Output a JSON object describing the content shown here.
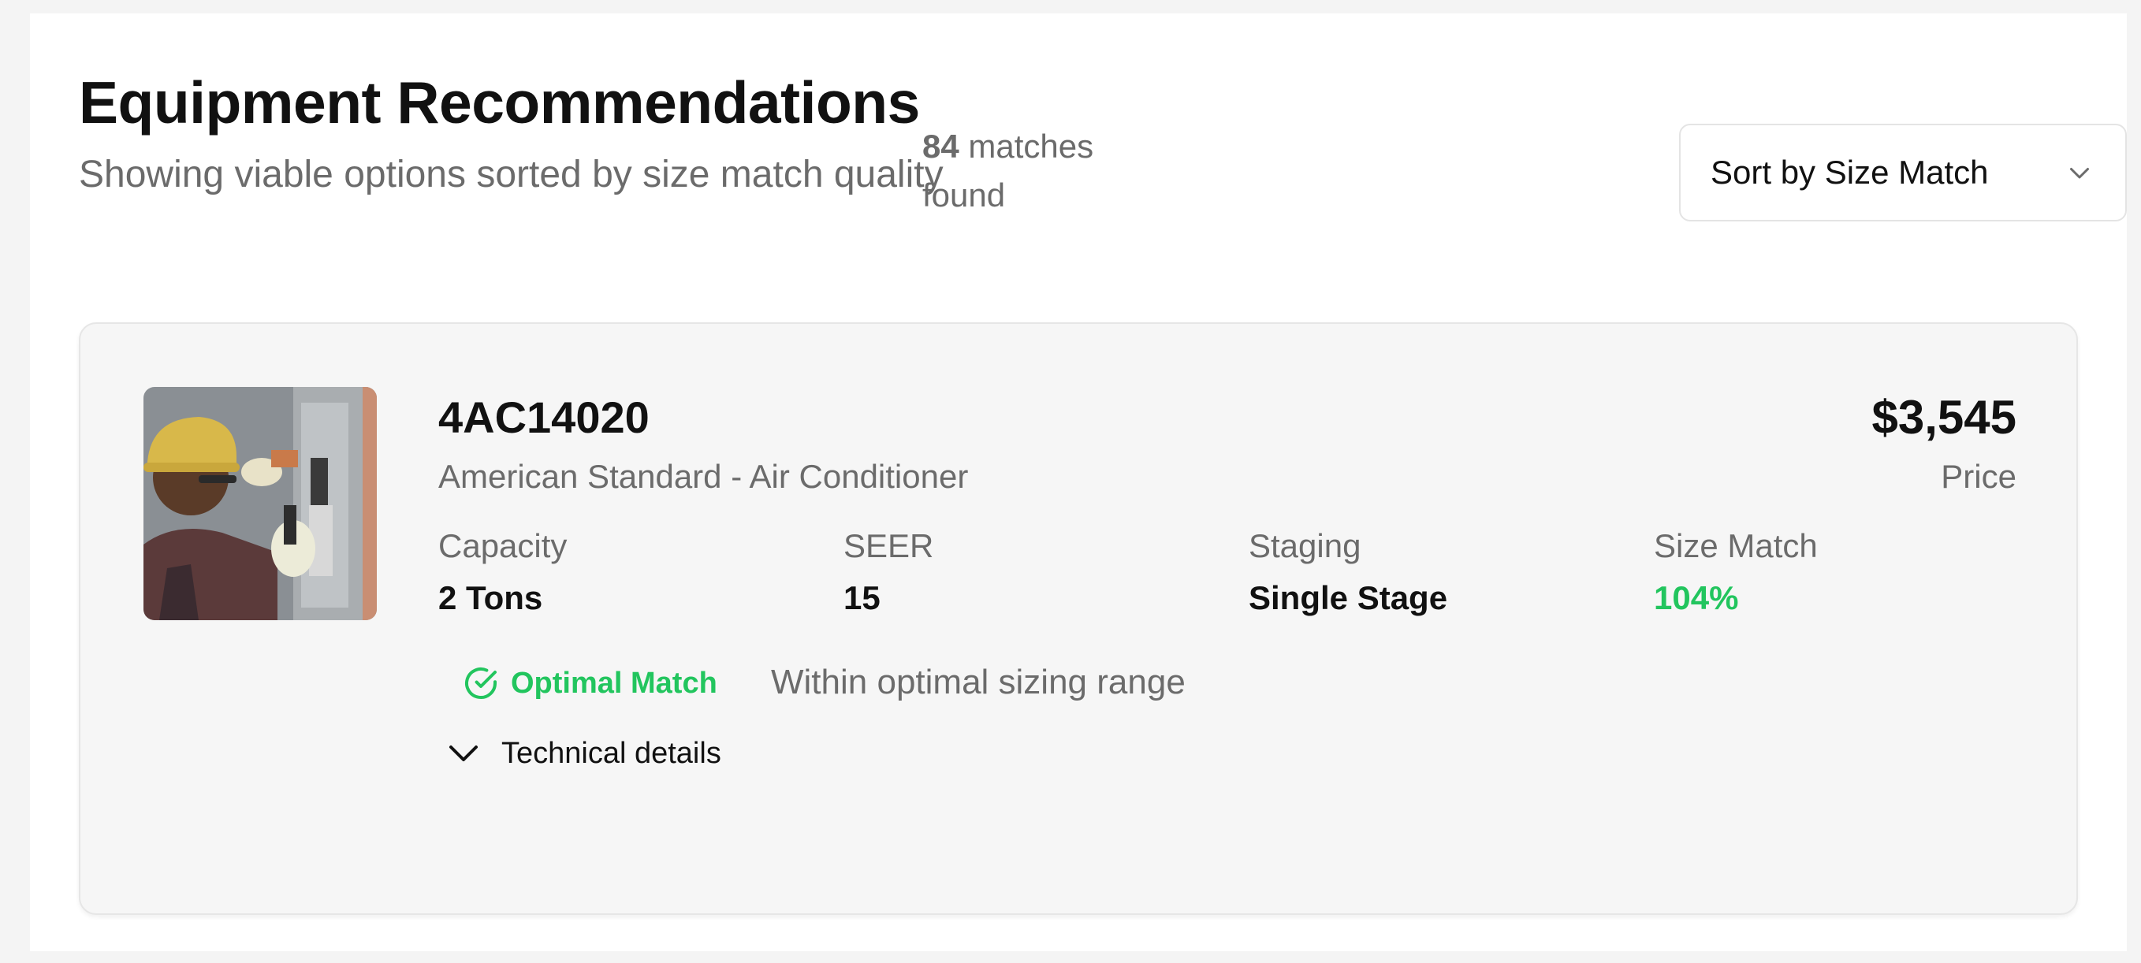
{
  "header": {
    "title": "Equipment Recommendations",
    "subtitle": "Showing viable options sorted by size match quality",
    "match_count": "84",
    "match_suffix": "matches found"
  },
  "sort": {
    "selected": "Sort by Size Match",
    "icon": "chevron-down-icon"
  },
  "product": {
    "model": "4AC14020",
    "brand": "American Standard - Air Conditioner",
    "price": "$3,545",
    "price_label": "Price",
    "image_alt": "technician inspecting electrical panel",
    "specs": [
      {
        "label": "Capacity",
        "value": "2 Tons"
      },
      {
        "label": "SEER",
        "value": "15"
      },
      {
        "label": "Staging",
        "value": "Single Stage"
      },
      {
        "label": "Size Match",
        "value": "104%"
      }
    ],
    "status": {
      "label": "Optimal Match",
      "description": "Within optimal sizing range",
      "icon": "check-circle-icon"
    },
    "details_toggle": "Technical details"
  },
  "colors": {
    "accent_green": "#22c55e",
    "muted_text": "#6b6b6b",
    "card_bg": "#f6f6f6"
  }
}
